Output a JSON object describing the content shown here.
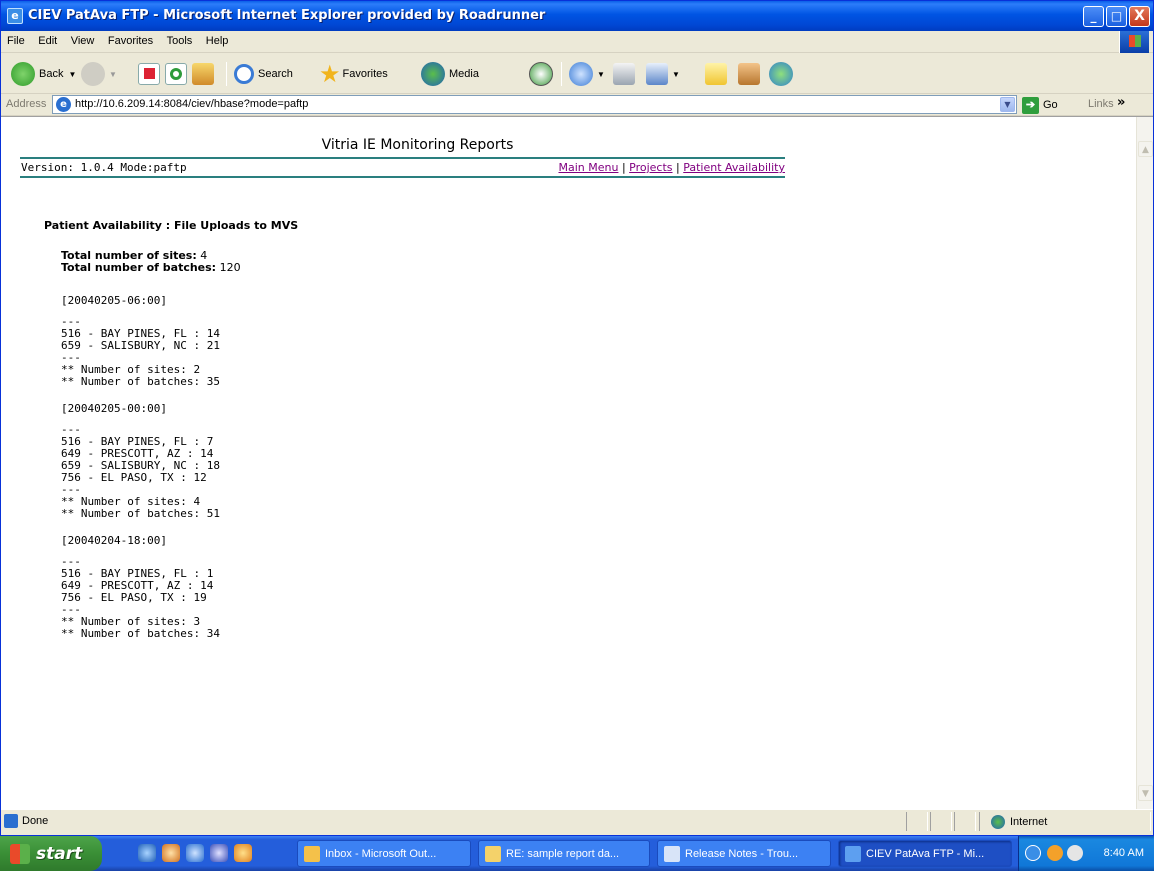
{
  "window": {
    "title": "CIEV PatAva FTP - Microsoft Internet Explorer provided by Roadrunner",
    "minimize": "_",
    "maximize": "□",
    "close": "X"
  },
  "menu": [
    "File",
    "Edit",
    "View",
    "Favorites",
    "Tools",
    "Help"
  ],
  "toolbar": {
    "back": "Back",
    "search": "Search",
    "favorites": "Favorites",
    "media": "Media"
  },
  "address": {
    "label": "Address",
    "url": "http://10.6.209.14:8084/ciev/hbase?mode=paftp",
    "go": "Go",
    "links": "Links"
  },
  "report": {
    "title": "Vitria IE Monitoring Reports",
    "version": "Version: 1.0.4  Mode:paftp",
    "nav": [
      "Main Menu",
      "Projects",
      "Patient Availability"
    ],
    "heading": "Patient Availability : File Uploads to MVS",
    "total_sites_label": "Total number of sites:",
    "total_sites": "4",
    "total_batches_label": "Total number of batches:",
    "total_batches": "120",
    "batches": [
      {
        "timestamp": "[20040205-06:00]",
        "sites": [
          "516 - BAY PINES, FL : 14",
          "659 - SALISBURY, NC : 21"
        ],
        "num_sites": "** Number of sites: 2",
        "num_batches": "** Number of batches: 35"
      },
      {
        "timestamp": "[20040205-00:00]",
        "sites": [
          "516 - BAY PINES, FL : 7",
          "649 - PRESCOTT, AZ : 14",
          "659 - SALISBURY, NC : 18",
          "756 - EL PASO, TX : 12"
        ],
        "num_sites": "** Number of sites: 4",
        "num_batches": "** Number of batches: 51"
      },
      {
        "timestamp": "[20040204-18:00]",
        "sites": [
          "516 - BAY PINES, FL : 1",
          "649 - PRESCOTT, AZ : 14",
          "756 - EL PASO, TX : 19"
        ],
        "num_sites": "** Number of sites: 3",
        "num_batches": "** Number of batches: 34"
      }
    ],
    "separator": "---"
  },
  "status": {
    "text": "Done",
    "zone": "Internet"
  },
  "taskbar": {
    "start": "start",
    "tasks": [
      "Inbox - Microsoft Out...",
      "RE: sample report da...",
      "Release Notes - Trou...",
      "CIEV PatAva FTP - Mi..."
    ],
    "clock": "8:40 AM"
  }
}
